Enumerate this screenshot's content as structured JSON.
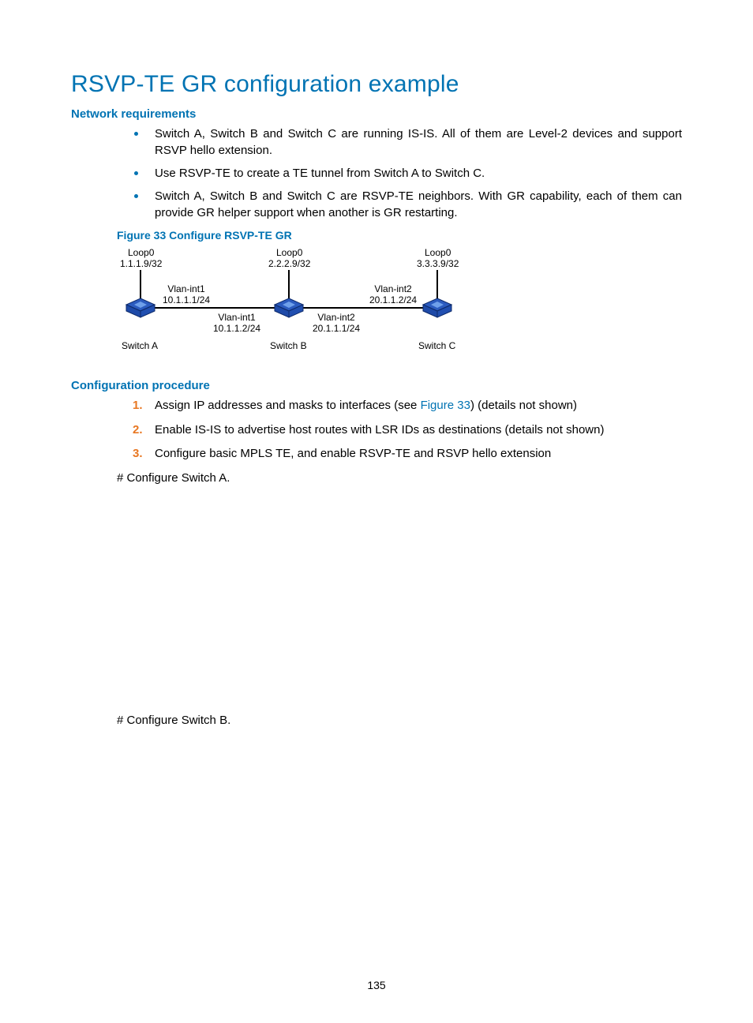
{
  "title": "RSVP-TE GR configuration example",
  "sections": {
    "network_req": {
      "heading": "Network requirements",
      "bullets": [
        "Switch A, Switch B and Switch C are running IS-IS. All of them are Level-2 devices and support RSVP hello extension.",
        "Use RSVP-TE to create a TE tunnel from Switch A to Switch C.",
        "Switch A, Switch B and Switch C are RSVP-TE neighbors. With GR capability, each of them can provide GR helper support when another is GR restarting."
      ]
    },
    "figure": {
      "caption": "Figure 33 Configure RSVP-TE GR",
      "nodes": {
        "a": {
          "name": "Switch A",
          "loop": "Loop0",
          "loop_ip": "1.1.1.9/32",
          "right_if": "Vlan-int1",
          "right_ip": "10.1.1.1/24"
        },
        "b": {
          "name": "Switch B",
          "loop": "Loop0",
          "loop_ip": "2.2.2.9/32",
          "left_if": "Vlan-int1",
          "left_ip": "10.1.1.2/24",
          "right_if": "Vlan-int2",
          "right_ip": "20.1.1.1/24"
        },
        "c": {
          "name": "Switch C",
          "loop": "Loop0",
          "loop_ip": "3.3.3.9/32",
          "left_if": "Vlan-int2",
          "left_ip": "20.1.1.2/24"
        }
      }
    },
    "config_proc": {
      "heading": "Configuration procedure",
      "steps": [
        {
          "pre": "Assign IP addresses and masks to interfaces (see ",
          "link": "Figure 33",
          "post": ") (details not shown)"
        },
        {
          "text": "Enable IS-IS to advertise host routes with LSR IDs as destinations (details not shown)"
        },
        {
          "text": "Configure basic MPLS TE, and enable RSVP-TE and RSVP hello extension"
        }
      ],
      "hash_a": "# Configure Switch A.",
      "hash_b": "# Configure Switch B."
    }
  },
  "page_number": "135"
}
